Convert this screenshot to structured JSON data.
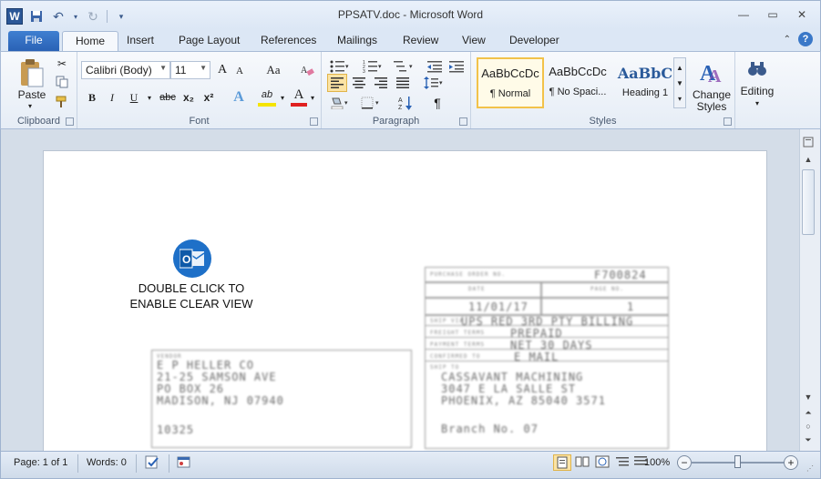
{
  "window": {
    "title": "PPSATV.doc  -  Microsoft Word",
    "app_icon_letter": "W"
  },
  "tabs": {
    "file": "File",
    "home": "Home",
    "insert": "Insert",
    "page_layout": "Page Layout",
    "references": "References",
    "mailings": "Mailings",
    "review": "Review",
    "view": "View",
    "developer": "Developer",
    "help_glyph": "?"
  },
  "ribbon": {
    "clipboard": {
      "label": "Clipboard",
      "paste": "Paste"
    },
    "font": {
      "label": "Font",
      "font_name": "Calibri (Body)",
      "font_size": "11",
      "grow": "A",
      "shrink": "A",
      "change_case": "Aa",
      "bold": "B",
      "italic": "I",
      "underline": "U",
      "strikethrough": "abc",
      "subscript": "x₂",
      "superscript": "x²",
      "font_color": "A",
      "highlight": "ab"
    },
    "paragraph": {
      "label": "Paragraph",
      "pilcrow": "¶"
    },
    "styles": {
      "label": "Styles",
      "items": [
        {
          "sample": "AaBbCcDc",
          "name": "¶ Normal"
        },
        {
          "sample": "AaBbCcDc",
          "name": "¶ No Spaci..."
        },
        {
          "sample": "AaBbC",
          "name": "Heading 1"
        }
      ],
      "change_styles": "Change Styles"
    },
    "editing": {
      "label": "Editing"
    }
  },
  "document": {
    "overlay_text_line1": "DOUBLE CLICK TO",
    "overlay_text_line2": "ENABLE CLEAR VIEW",
    "scan": {
      "po_number": "F700824",
      "date": "11/01/17",
      "page": "1",
      "ship_via": "UPS RED 3RD PTY BILLING",
      "freight_terms": "PREPAID",
      "payment_terms": "NET 30 DAYS",
      "confirm": "E MAIL",
      "vendor_lines": [
        "E P HELLER CO",
        "21-25 SAMSON AVE",
        "PO BOX 26",
        "MADISON, NJ  07940",
        "",
        "10325"
      ],
      "shipto_lines": [
        "CASSAVANT MACHINING",
        "3047 E LA SALLE ST",
        "PHOENIX, AZ  85040 3571",
        "",
        "Branch No. 07"
      ],
      "labels": {
        "po": "PURCHASE ORDER NO.",
        "date": "DATE",
        "page": "PAGE NO.",
        "ship_via": "SHIP VIA",
        "freight": "FREIGHT TERMS",
        "payment": "PAYMENT TERMS",
        "confirm": "CONFIRMED TO",
        "ship_to": "SHIP TO",
        "vendor": "VENDOR"
      }
    }
  },
  "statusbar": {
    "page": "Page: 1 of 1",
    "words": "Words: 0",
    "zoom": "100%"
  },
  "colors": {
    "accent": "#2a62b5",
    "outlook_blue": "#1e70c8"
  }
}
